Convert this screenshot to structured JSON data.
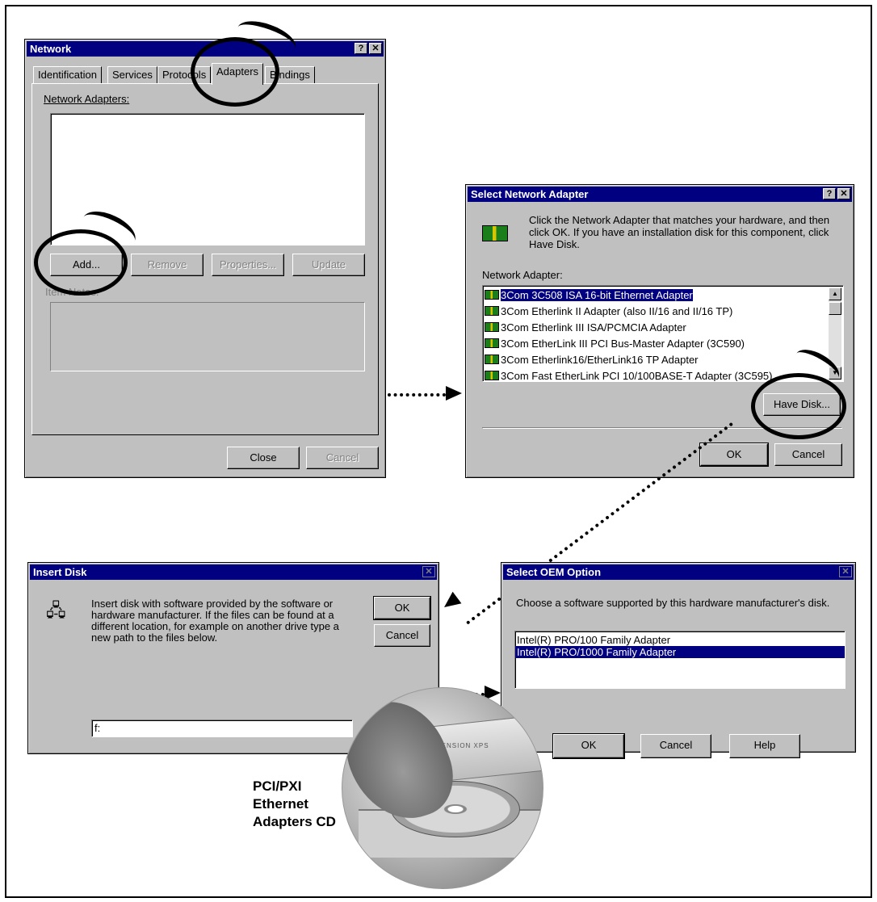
{
  "network_dialog": {
    "title": "Network",
    "title_buttons": [
      "?",
      "✕"
    ],
    "tabs": [
      "Identification",
      "Services",
      "Protocols",
      "Adapters",
      "Bindings"
    ],
    "active_tab": "Adapters",
    "list_label": "Network Adapters:",
    "buttons": {
      "add": "Add...",
      "remove": "Remove",
      "properties": "Properties...",
      "update": "Update"
    },
    "item_notes_label": "Item Notes:",
    "close": "Close",
    "cancel": "Cancel"
  },
  "select_adapter_dialog": {
    "title": "Select Network Adapter",
    "title_buttons": [
      "?",
      "✕"
    ],
    "instructions": "Click the Network Adapter that matches your hardware, and then click OK.  If you have an installation disk for this component, click Have Disk.",
    "list_label": "Network Adapter:",
    "adapters": [
      "3Com 3C508 ISA 16-bit Ethernet Adapter",
      "3Com Etherlink II Adapter (also II/16 and II/16 TP)",
      "3Com Etherlink III ISA/PCMCIA Adapter",
      "3Com EtherLink III PCI Bus-Master Adapter (3C590)",
      "3Com Etherlink16/EtherLink16 TP Adapter",
      "3Com Fast EtherLink PCI 10/100BASE-T Adapter (3C595)"
    ],
    "selected_index": 0,
    "have_disk": "Have Disk...",
    "ok": "OK",
    "cancel": "Cancel"
  },
  "insert_disk_dialog": {
    "title": "Insert Disk",
    "message": "Insert disk with software provided by the software or hardware manufacturer.  If the files can be found at a different location, for example on another drive type a new path to the files below.",
    "ok": "OK",
    "cancel": "Cancel",
    "path_value": "f:"
  },
  "oem_dialog": {
    "title": "Select OEM Option",
    "prompt": "Choose a software supported by this hardware manufacturer's disk.",
    "options": [
      "Intel(R) PRO/100 Family Adapter",
      "Intel(R) PRO/1000 Family Adapter"
    ],
    "selected_index": 1,
    "ok": "OK",
    "cancel": "Cancel",
    "help": "Help"
  },
  "photo": {
    "brand_text": "DIMENSION XPS",
    "caption_lines": [
      "PCI/PXI",
      "Ethernet",
      "Adapters CD"
    ]
  },
  "colors": {
    "titlebar": "#000080",
    "dialog": "#c0c0c0",
    "selection": "#000080"
  }
}
